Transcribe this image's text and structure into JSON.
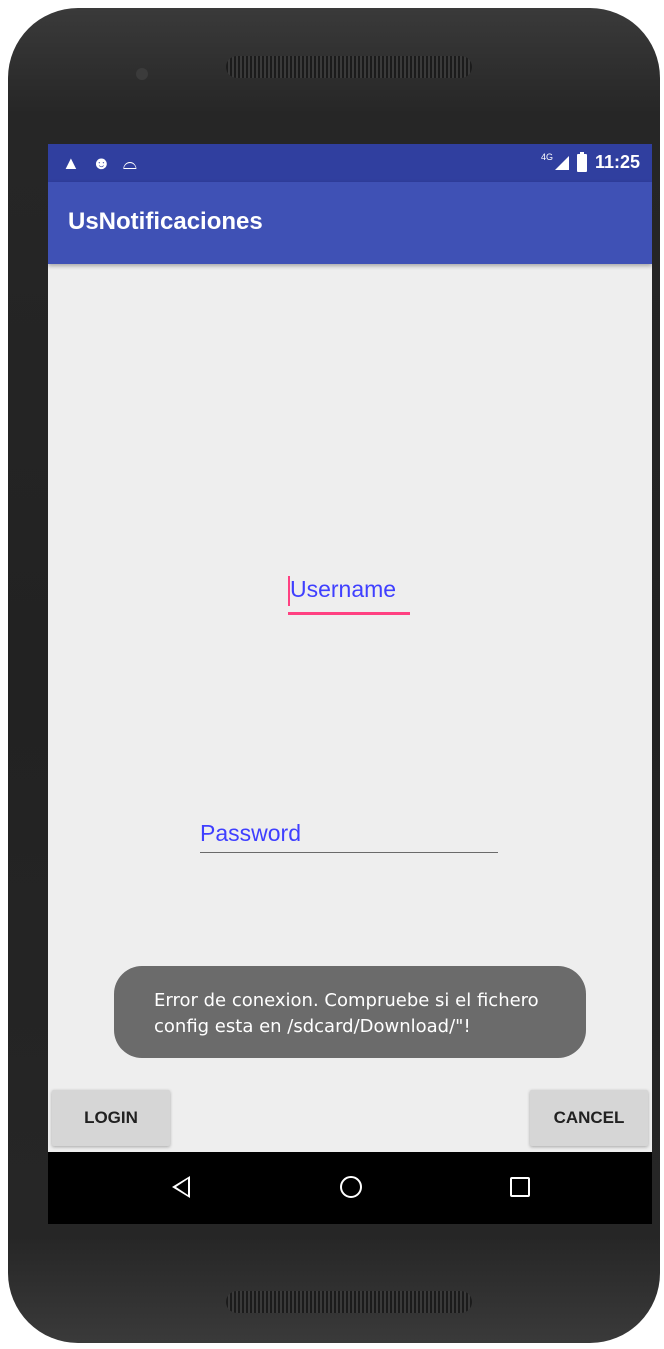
{
  "status_bar": {
    "left_icons": [
      "warning-icon",
      "debug-icon",
      "missed-call-icon"
    ],
    "network_type": "4G",
    "time": "11:25"
  },
  "app_bar": {
    "title": "UsNotificaciones"
  },
  "form": {
    "username_placeholder": "Username",
    "password_placeholder": "Password"
  },
  "toast": {
    "message": "Error de conexion. Compruebe si el fichero config esta en /sdcard/Download/\"!"
  },
  "buttons": {
    "login_label": "LOGIN",
    "cancel_label": "CANCEL"
  },
  "nav_bar": {
    "icons": [
      "back-icon",
      "home-icon",
      "recent-apps-icon"
    ]
  },
  "colors": {
    "status_bar": "#303F9F",
    "app_bar": "#3F51B5",
    "accent": "#FF4081",
    "hint_text": "#3F3FFF",
    "toast_background": "#6b6b6b"
  }
}
